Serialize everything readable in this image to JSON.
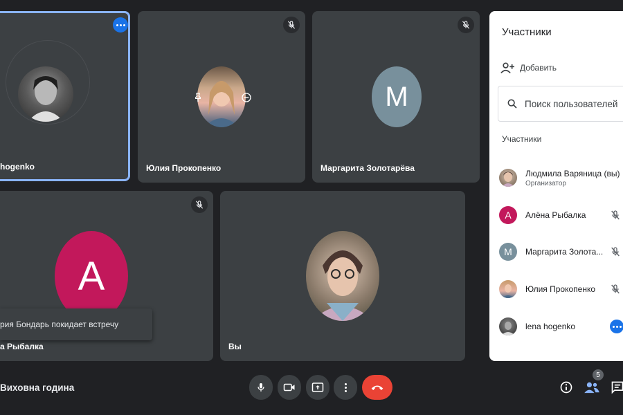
{
  "tiles": [
    {
      "name": "lena hogenko",
      "visible_name": "hogenko"
    },
    {
      "name": "Юлия Прокопенко"
    },
    {
      "name": "Маргарита Золотарёва",
      "initial": "M",
      "color": "#78909c"
    },
    {
      "name": "Алёна Рыбалка",
      "visible_name": "а Рыбалка",
      "initial": "A",
      "color": "#c2185b"
    },
    {
      "name": "Вы"
    }
  ],
  "toast": {
    "text": "рия Бондарь покидает встречу"
  },
  "panel": {
    "title": "Участники",
    "add_label": "Добавить",
    "search_placeholder": "Поиск пользователей",
    "section_label": "Участники",
    "participants": [
      {
        "name": "Людмила Варяница (вы)",
        "role": "Организатор",
        "icon": "photo"
      },
      {
        "name": "Алёна Рыбалка",
        "initial": "A",
        "color": "#c2185b",
        "icon": "mic-off-icon"
      },
      {
        "name": "Маргарита Золота...",
        "initial": "M",
        "color": "#78909c",
        "icon": "mic-off-icon"
      },
      {
        "name": "Юлия Прокопенко",
        "icon": "mic-off-icon"
      },
      {
        "name": "lena hogenko",
        "icon": "more-icon"
      }
    ]
  },
  "bottom": {
    "meeting_title": "Виховна година",
    "participants_count": "5"
  },
  "colors": {
    "accent": "#1a73e8",
    "end_call": "#ea4335",
    "background": "#202124",
    "tile": "#3c4043"
  }
}
